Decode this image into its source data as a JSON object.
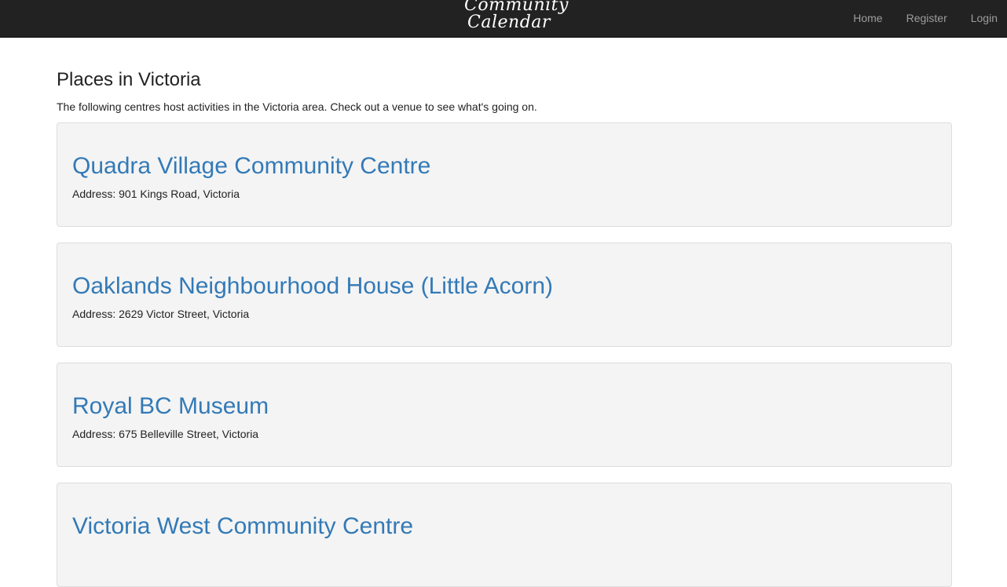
{
  "brand": {
    "line1": "Community",
    "line2": "Calendar"
  },
  "nav": {
    "items": [
      {
        "label": "Home"
      },
      {
        "label": "Register"
      },
      {
        "label": "Login"
      }
    ]
  },
  "page": {
    "title": "Places in Victoria",
    "intro": "The following centres host activities in the Victoria area. Check out a venue to see what's going on."
  },
  "venues": [
    {
      "name": "Quadra Village Community Centre",
      "address": "Address: 901 Kings Road, Victoria"
    },
    {
      "name": "Oaklands Neighbourhood House (Little Acorn)",
      "address": "Address: 2629 Victor Street, Victoria"
    },
    {
      "name": "Royal BC Museum",
      "address": "Address: 675 Belleville Street, Victoria"
    },
    {
      "name": "Victoria West Community Centre",
      "address": ""
    }
  ],
  "colors": {
    "navbar": "#222222",
    "link": "#337ab7",
    "card": "#f4f4f4"
  }
}
